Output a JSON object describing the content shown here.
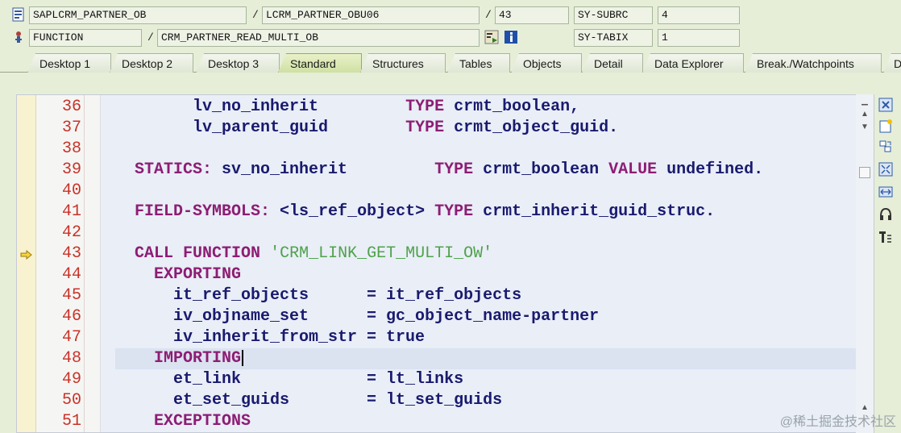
{
  "row1": {
    "program": "SAPLCRM_PARTNER_OB",
    "include": "LCRM_PARTNER_OBU06",
    "line": "43",
    "sysvar_name": "SY-SUBRC",
    "sysvar_value": "4"
  },
  "row2": {
    "event_type": "FUNCTION",
    "event_name": "CRM_PARTNER_READ_MULTI_OB",
    "sysvar_name": "SY-TABIX",
    "sysvar_value": "1"
  },
  "separators": {
    "slash": "/"
  },
  "tabs": [
    {
      "label": "Desktop 1"
    },
    {
      "label": "Desktop 2"
    },
    {
      "label": "Desktop 3"
    },
    {
      "label": "Standard",
      "active": true
    },
    {
      "label": "Structures"
    },
    {
      "label": "Tables"
    },
    {
      "label": "Objects"
    },
    {
      "label": "Detail"
    },
    {
      "label": "Data Explorer"
    },
    {
      "label": "Break./Watchpoints"
    },
    {
      "label": "D"
    }
  ],
  "code_lines": [
    {
      "num": "36",
      "text": "        lv_no_inherit         TYPE crmt_boolean,"
    },
    {
      "num": "37",
      "text": "        lv_parent_guid        TYPE crmt_object_guid."
    },
    {
      "num": "38",
      "text": ""
    },
    {
      "num": "39",
      "text": "  STATICS: sv_no_inherit         TYPE crmt_boolean VALUE undefined."
    },
    {
      "num": "40",
      "text": ""
    },
    {
      "num": "41",
      "text": "  FIELD-SYMBOLS: <ls_ref_object> TYPE crmt_inherit_guid_struc."
    },
    {
      "num": "42",
      "text": ""
    },
    {
      "num": "43",
      "text": "  CALL FUNCTION 'CRM_LINK_GET_MULTI_OW'"
    },
    {
      "num": "44",
      "text": "    EXPORTING"
    },
    {
      "num": "45",
      "text": "      it_ref_objects      = it_ref_objects"
    },
    {
      "num": "46",
      "text": "      iv_objname_set      = gc_object_name-partner"
    },
    {
      "num": "47",
      "text": "      iv_inherit_from_str = true"
    },
    {
      "num": "48",
      "text": "    IMPORTING"
    },
    {
      "num": "49",
      "text": "      et_link             = lt_links"
    },
    {
      "num": "50",
      "text": "      et_set_guids        = lt_set_guids"
    },
    {
      "num": "51",
      "text": "    EXCEPTIONS"
    }
  ],
  "current_line": "43",
  "cursor_line": "48",
  "watermark": "@稀土掘金技术社区",
  "icons": {
    "row1": "program-icon",
    "row2": "function-icon",
    "navigate": "navigate-icon",
    "info": "info-icon",
    "exec_arrow": "execution-arrow-icon",
    "toolbar": [
      "close-icon",
      "new-note-icon",
      "refresh-icon",
      "fullscreen-icon",
      "expand-width-icon",
      "headset-icon",
      "format-icon"
    ]
  },
  "colors": {
    "line_numbers": "#c8322a",
    "keywords": "#8d1d74",
    "identifiers": "#1a1a6e",
    "strings": "#4fa24a",
    "active_tab": "#cfe0a4"
  }
}
